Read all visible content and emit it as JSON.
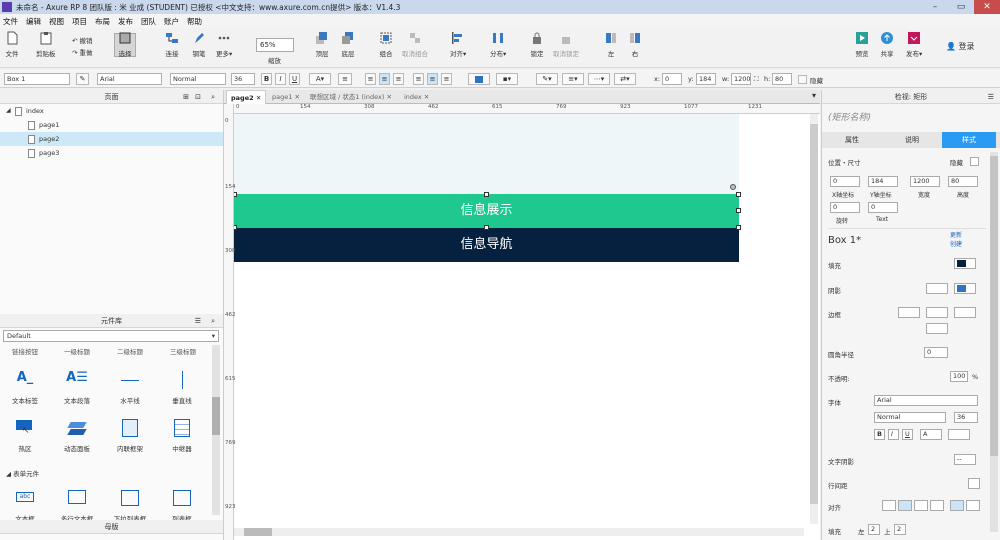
{
  "title_bar": {
    "text": "未命名 - Axure RP 8 团队版 : 米 业成 (STUDENT) 已授权     <中文支持：www.axure.com.cn提供> 版本：V1.4.3"
  },
  "menu": [
    "文件",
    "编辑",
    "视图",
    "项目",
    "布局",
    "发布",
    "团队",
    "账户",
    "帮助"
  ],
  "toolbar": {
    "file": "文件",
    "clipboard": "剪贴板",
    "undo": "撤销",
    "redo": "重做",
    "select": "选择",
    "connect": "连接",
    "pen": "钢笔",
    "more": "更多▾",
    "zoom_value": "65%",
    "zoom_label": "缩放",
    "top": "顶层",
    "bottom": "底层",
    "group": "组合",
    "ungroup": "取消组合",
    "align": "对齐▾",
    "distribute": "分布▾",
    "lock": "锁定",
    "unlock": "取消锁定",
    "left": "左",
    "right": "右",
    "preview": "预览",
    "share": "共享",
    "publish": "发布▾",
    "login": "登录"
  },
  "format": {
    "style": "Box 1",
    "font": "Arial",
    "weight": "Normal",
    "size": "36",
    "x_label": "x:",
    "x": "0",
    "y_label": "y:",
    "y": "184",
    "w_label": "w:",
    "w": "1200",
    "h_label": "h:",
    "h": "80",
    "hidden": "隐藏",
    "bold": "B",
    "italic": "I",
    "underline": "U"
  },
  "pages_panel": {
    "title": "页面",
    "items": [
      {
        "label": "index"
      },
      {
        "label": "page1"
      },
      {
        "label": "page2"
      },
      {
        "label": "page3"
      }
    ]
  },
  "library_panel": {
    "title": "元件库",
    "library": "Default",
    "headings": [
      "链接按钮",
      "一级标题",
      "二级标题",
      "三级标题"
    ],
    "widgets": [
      {
        "label": "文本标签"
      },
      {
        "label": "文本段落"
      },
      {
        "label": "水平线"
      },
      {
        "label": "垂直线"
      },
      {
        "label": "热区"
      },
      {
        "label": "动态面板"
      },
      {
        "label": "内联框架"
      },
      {
        "label": "中继器"
      }
    ],
    "form_section": "表单元件",
    "form_widgets": [
      {
        "label": "文本框"
      },
      {
        "label": "多行文本框"
      },
      {
        "label": "下拉列表框"
      },
      {
        "label": "列表框"
      }
    ],
    "footer": "母版"
  },
  "tabs": [
    {
      "label": "page2"
    },
    {
      "label": "page1"
    },
    {
      "label": "联想区域 / 状态1 (index)"
    },
    {
      "label": "index"
    }
  ],
  "ruler_h": [
    "0",
    "154",
    "308",
    "462",
    "615",
    "769",
    "923",
    "1077",
    "1231"
  ],
  "ruler_v": [
    "0",
    "154",
    "308",
    "462",
    "615",
    "769",
    "923"
  ],
  "canvas": {
    "box1_text": "信息展示",
    "box2_text": "信息导航",
    "box1_color": "#1ec88f",
    "box2_color": "#06213f"
  },
  "inspector": {
    "title": "检视: 矩形",
    "name_placeholder": "(矩形名称)",
    "tabs": [
      "属性",
      "说明",
      "样式"
    ],
    "pos_size": "位置・尺寸",
    "hidden": "隐藏",
    "x": "0",
    "y": "184",
    "w": "1200",
    "h": "80",
    "x_label": "X轴坐标",
    "y_label": "Y轴坐标",
    "w_label": "宽度",
    "h_label": "高度",
    "r1": "0",
    "r2": "0",
    "rotate": "旋转",
    "text": "Text",
    "style_name": "Box 1*",
    "update": "更新",
    "create": "创建",
    "fill": "填充",
    "shadow": "阴影",
    "border": "边框",
    "radius": "圆角半径",
    "radius_val": "0",
    "opacity": "不透明:",
    "opacity_val": "100",
    "pct": "%",
    "font": "字体",
    "font_val": "Arial",
    "weight_val": "Normal",
    "size_val": "36",
    "b": "B",
    "i": "I",
    "u": "U",
    "text_color": "A",
    "text_shadow": "文字阴影",
    "fill_bottom": "填充",
    "left": "左",
    "left_val": "2",
    "top": "上",
    "top_val": "2",
    "line": "行间距",
    "align": "对齐",
    "dash": "--"
  }
}
